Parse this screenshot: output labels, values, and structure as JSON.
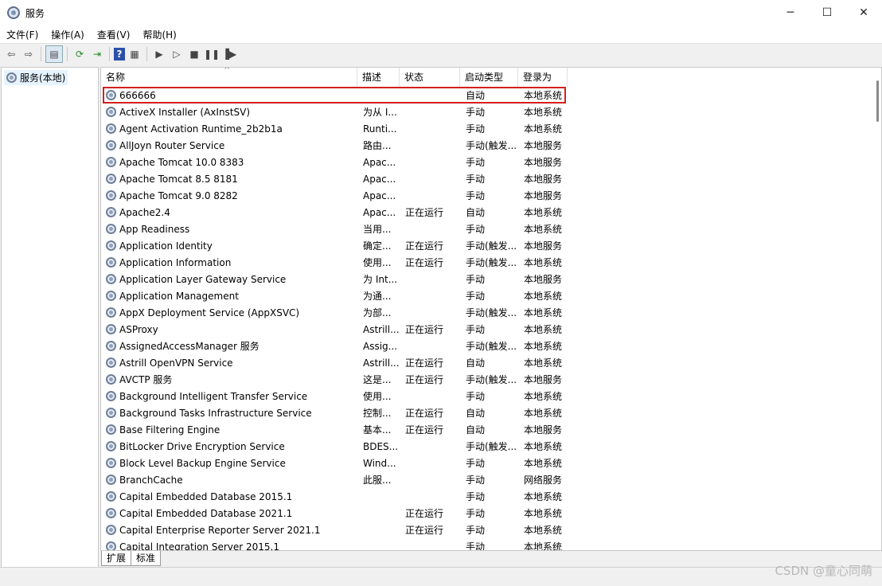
{
  "window": {
    "title": "服务"
  },
  "menu": [
    "文件(F)",
    "操作(A)",
    "查看(V)",
    "帮助(H)"
  ],
  "tree": {
    "label": "服务(本地)"
  },
  "columns": [
    "名称",
    "描述",
    "状态",
    "启动类型",
    "登录为"
  ],
  "rows": [
    {
      "name": "666666",
      "desc": "",
      "status": "",
      "startup": "自动",
      "logon": "本地系统"
    },
    {
      "name": "ActiveX Installer (AxInstSV)",
      "desc": "为从 I...",
      "status": "",
      "startup": "手动",
      "logon": "本地系统"
    },
    {
      "name": "Agent Activation Runtime_2b2b1a",
      "desc": "Runti...",
      "status": "",
      "startup": "手动",
      "logon": "本地系统"
    },
    {
      "name": "AllJoyn Router Service",
      "desc": "路由...",
      "status": "",
      "startup": "手动(触发...",
      "logon": "本地服务"
    },
    {
      "name": "Apache Tomcat 10.0 8383",
      "desc": "Apac...",
      "status": "",
      "startup": "手动",
      "logon": "本地服务"
    },
    {
      "name": "Apache Tomcat 8.5 8181",
      "desc": "Apac...",
      "status": "",
      "startup": "手动",
      "logon": "本地服务"
    },
    {
      "name": "Apache Tomcat 9.0 8282",
      "desc": "Apac...",
      "status": "",
      "startup": "手动",
      "logon": "本地服务"
    },
    {
      "name": "Apache2.4",
      "desc": "Apac...",
      "status": "正在运行",
      "startup": "自动",
      "logon": "本地系统"
    },
    {
      "name": "App Readiness",
      "desc": "当用...",
      "status": "",
      "startup": "手动",
      "logon": "本地系统"
    },
    {
      "name": "Application Identity",
      "desc": "确定...",
      "status": "正在运行",
      "startup": "手动(触发...",
      "logon": "本地服务"
    },
    {
      "name": "Application Information",
      "desc": "使用...",
      "status": "正在运行",
      "startup": "手动(触发...",
      "logon": "本地系统"
    },
    {
      "name": "Application Layer Gateway Service",
      "desc": "为 Int...",
      "status": "",
      "startup": "手动",
      "logon": "本地服务"
    },
    {
      "name": "Application Management",
      "desc": "为通...",
      "status": "",
      "startup": "手动",
      "logon": "本地系统"
    },
    {
      "name": "AppX Deployment Service (AppXSVC)",
      "desc": "为部...",
      "status": "",
      "startup": "手动(触发...",
      "logon": "本地系统"
    },
    {
      "name": "ASProxy",
      "desc": "Astrill...",
      "status": "正在运行",
      "startup": "手动",
      "logon": "本地系统"
    },
    {
      "name": "AssignedAccessManager 服务",
      "desc": "Assig...",
      "status": "",
      "startup": "手动(触发...",
      "logon": "本地系统"
    },
    {
      "name": "Astrill OpenVPN Service",
      "desc": "Astrill...",
      "status": "正在运行",
      "startup": "自动",
      "logon": "本地系统"
    },
    {
      "name": "AVCTP 服务",
      "desc": "这是...",
      "status": "正在运行",
      "startup": "手动(触发...",
      "logon": "本地服务"
    },
    {
      "name": "Background Intelligent Transfer Service",
      "desc": "使用...",
      "status": "",
      "startup": "手动",
      "logon": "本地系统"
    },
    {
      "name": "Background Tasks Infrastructure Service",
      "desc": "控制...",
      "status": "正在运行",
      "startup": "自动",
      "logon": "本地系统"
    },
    {
      "name": "Base Filtering Engine",
      "desc": "基本...",
      "status": "正在运行",
      "startup": "自动",
      "logon": "本地服务"
    },
    {
      "name": "BitLocker Drive Encryption Service",
      "desc": "BDES...",
      "status": "",
      "startup": "手动(触发...",
      "logon": "本地系统"
    },
    {
      "name": "Block Level Backup Engine Service",
      "desc": "Wind...",
      "status": "",
      "startup": "手动",
      "logon": "本地系统"
    },
    {
      "name": "BranchCache",
      "desc": "此服...",
      "status": "",
      "startup": "手动",
      "logon": "网络服务"
    },
    {
      "name": "Capital Embedded Database 2015.1",
      "desc": "",
      "status": "",
      "startup": "手动",
      "logon": "本地系统"
    },
    {
      "name": "Capital Embedded Database 2021.1",
      "desc": "",
      "status": "正在运行",
      "startup": "手动",
      "logon": "本地系统"
    },
    {
      "name": "Capital Enterprise Reporter Server 2021.1",
      "desc": "",
      "status": "正在运行",
      "startup": "手动",
      "logon": "本地系统"
    },
    {
      "name": "Capital Integration Server 2015.1",
      "desc": "",
      "status": "",
      "startup": "手动",
      "logon": "本地系统"
    }
  ],
  "tabs": [
    "扩展",
    "标准"
  ],
  "watermark": "CSDN @童心同萌",
  "colors": {
    "highlight": "#d32020",
    "selection": "#e5f3ff"
  }
}
